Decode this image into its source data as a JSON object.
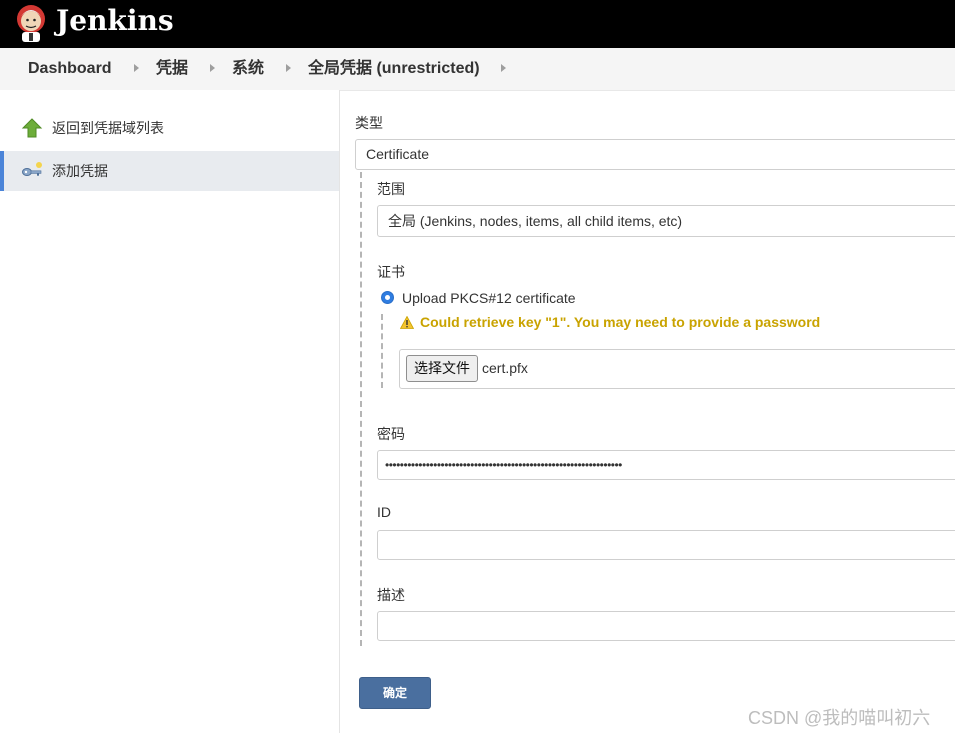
{
  "header": {
    "brand": "Jenkins",
    "logo_icon": "jenkins-butler-logo"
  },
  "breadcrumb": [
    "Dashboard",
    "凭据",
    "系统",
    "全局凭据 (unrestricted)"
  ],
  "sidebar": {
    "items": [
      {
        "label": "返回到凭据域列表",
        "icon": "up-arrow-icon"
      },
      {
        "label": "添加凭据",
        "icon": "key-icon"
      }
    ]
  },
  "form": {
    "type_label": "类型",
    "type_value": "Certificate",
    "scope_label": "范围",
    "scope_value": "全局 (Jenkins, nodes, items, all child items, etc)",
    "cert_label": "证书",
    "upload_option": "Upload PKCS#12 certificate",
    "warning": "Could retrieve key \"1\". You may need to provide a password",
    "file_button": "选择文件",
    "file_name": "cert.pfx",
    "password_label": "密码",
    "password_value": "••••••••••••••••••••••••••••••••••••••••••••••••••••••••••••••••",
    "id_label": "ID",
    "id_value": "",
    "desc_label": "描述",
    "desc_value": "",
    "submit": "确定"
  },
  "watermark": "CSDN @我的喵叫初六",
  "colors": {
    "header_bg": "#000000",
    "accent_blue": "#4b84d8",
    "warning": "#c9a300",
    "submit_bg": "#4a6f9f"
  }
}
